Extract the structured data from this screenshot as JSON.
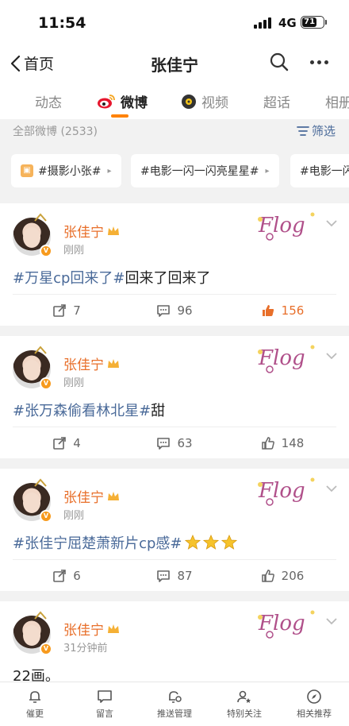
{
  "status": {
    "time": "11:54",
    "network": "4G",
    "battery": "71"
  },
  "nav": {
    "back_label": "首页",
    "title": "张佳宁"
  },
  "tabs": [
    {
      "label": "动态"
    },
    {
      "label": "微博"
    },
    {
      "label": "视频"
    },
    {
      "label": "超话"
    },
    {
      "label": "相册"
    }
  ],
  "filter": {
    "label": "全部微博 (2533)",
    "button": "筛选"
  },
  "topics": [
    {
      "label": "#摄影小张#"
    },
    {
      "label": "#电影一闪一闪亮星星#"
    },
    {
      "label": "#电影一闪"
    }
  ],
  "posts": [
    {
      "name": "张佳宁",
      "time": "刚刚",
      "text_tag": "#万星cp回来了#",
      "text_rest": "回来了回来了",
      "reposts": "7",
      "comments": "96",
      "likes": "156",
      "liked": true
    },
    {
      "name": "张佳宁",
      "time": "刚刚",
      "text_tag": "#张万森偷看林北星#",
      "text_rest": "甜",
      "reposts": "4",
      "comments": "63",
      "likes": "148",
      "liked": false
    },
    {
      "name": "张佳宁",
      "time": "刚刚",
      "text_tag": "#张佳宁屈楚萧新片cp感#",
      "text_rest": "",
      "reposts": "6",
      "comments": "87",
      "likes": "206",
      "liked": false
    },
    {
      "name": "张佳宁",
      "time": "31分钟前",
      "text_tag": "",
      "text_rest": "22画。"
    }
  ],
  "bottom": [
    {
      "label": "催更",
      "icon": "bell-icon"
    },
    {
      "label": "留言",
      "icon": "message-icon"
    },
    {
      "label": "推送管理",
      "icon": "bell-settings-icon"
    },
    {
      "label": "特别关注",
      "icon": "user-star-icon"
    },
    {
      "label": "相关推荐",
      "icon": "compass-icon"
    }
  ],
  "colors": {
    "accent": "#ff8200",
    "link": "#4a6a99",
    "name": "#e86f2a"
  }
}
